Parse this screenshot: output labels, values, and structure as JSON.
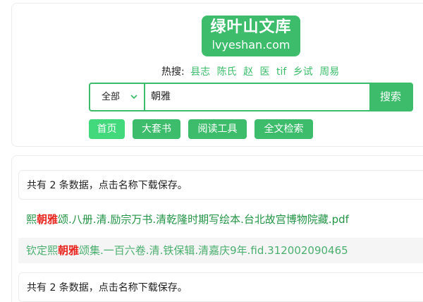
{
  "logo": {
    "title": "绿叶山文库",
    "domain": "lvyeshan.com"
  },
  "hot_search": {
    "label": "热搜:",
    "links": [
      "县志",
      "陈氏",
      "赵",
      "医",
      "tif",
      "乡试",
      "周易"
    ]
  },
  "search": {
    "scope_value": "全部",
    "query": "朝雅",
    "button_label": "搜索"
  },
  "nav": {
    "items": [
      "首页",
      "大套书",
      "阅读工具",
      "全文检索"
    ]
  },
  "results": {
    "summary_top": "共有 2 条数据，点击名称下载保存。",
    "summary_bottom": "共有 2 条数据，点击名称下载保存。",
    "items": [
      {
        "prefix": "熙",
        "highlight": "朝雅",
        "suffix": "颂.八册.清.励宗万书.清乾隆时期写绘本.台北故宫博物院藏.pdf"
      },
      {
        "prefix": "钦定熙",
        "highlight": "朝雅",
        "suffix": "颂集.一百六卷.清.铁保辑.清嘉庆9年.fid.312002090465"
      }
    ]
  },
  "colors": {
    "brand": "#3dbd6b",
    "highlight": "#e8261f"
  }
}
